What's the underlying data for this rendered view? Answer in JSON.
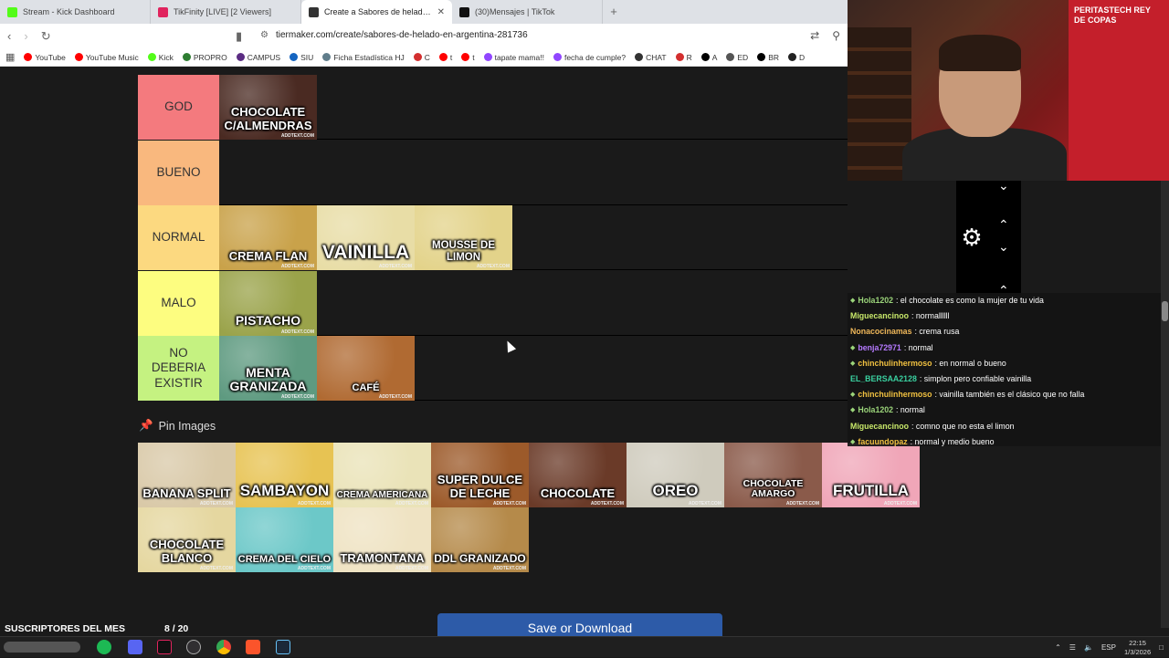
{
  "browser": {
    "tabs": [
      {
        "title": "Stream - Kick Dashboard",
        "color": "#53fc18"
      },
      {
        "title": "TikFinity [LIVE] [2 Viewers]",
        "color": "#e0245e"
      },
      {
        "title": "Create a Sabores de helado en A",
        "color": "#333333",
        "active": true
      },
      {
        "title": "(30)Mensajes | TikTok",
        "color": "#111111"
      }
    ],
    "new_tab": "+",
    "url": "tiermaker.com/create/sabores-de-helado-en-argentina-281736",
    "bookmarks": [
      {
        "label": "YouTube",
        "color": "#ff0000"
      },
      {
        "label": "YouTube Music",
        "color": "#ff0000"
      },
      {
        "label": "Kick",
        "color": "#53fc18"
      },
      {
        "label": "PROPRO",
        "color": "#2e7d32"
      },
      {
        "label": "CAMPUS",
        "color": "#5b2c83"
      },
      {
        "label": "SIU",
        "color": "#1565c0"
      },
      {
        "label": "Ficha Estadística HJ",
        "color": "#607d8b"
      },
      {
        "label": "C",
        "color": "#d32f2f"
      },
      {
        "label": "t",
        "color": "#ff0000"
      },
      {
        "label": "t",
        "color": "#ff0000"
      },
      {
        "label": "tapate mama!!",
        "color": "#9146ff"
      },
      {
        "label": "fecha de cumple?",
        "color": "#9146ff"
      },
      {
        "label": "CHAT",
        "color": "#333333"
      },
      {
        "label": "R",
        "color": "#d32f2f"
      },
      {
        "label": "A",
        "color": "#000000"
      },
      {
        "label": "ED",
        "color": "#555555"
      },
      {
        "label": "BR",
        "color": "#000000"
      },
      {
        "label": "D",
        "color": "#222222"
      }
    ]
  },
  "tiers": [
    {
      "label": "GOD",
      "color": "#f47a7e",
      "items": [
        {
          "label": "CHOCOLATE C/ALMENDRAS",
          "bg": "#4a2a22",
          "size": 13
        }
      ]
    },
    {
      "label": "BUENO",
      "color": "#f9b87e",
      "items": []
    },
    {
      "label": "NORMAL",
      "color": "#fcd980",
      "items": [
        {
          "label": "CREMA FLAN",
          "bg": "#c9a24a",
          "size": 13
        },
        {
          "label": "VAINILLA",
          "bg": "#e8dda6",
          "size": 21
        },
        {
          "label": "MOUSSE DE LIMON",
          "bg": "#e3d38a",
          "size": 11.5
        }
      ]
    },
    {
      "label": "MALO",
      "color": "#fdfd80",
      "items": [
        {
          "label": "PISTACHO",
          "bg": "#9aa34a",
          "size": 14
        }
      ]
    },
    {
      "label": "NO DEBERIA EXISTIR",
      "color": "#c5f281",
      "items": [
        {
          "label": "MENTA GRANIZADA",
          "bg": "#5e9a80",
          "size": 14
        },
        {
          "label": "CAFÉ",
          "bg": "#b06a32",
          "size": 11
        }
      ]
    }
  ],
  "pin": {
    "title": "Pin Images",
    "items": [
      {
        "label": "BANANA SPLIT",
        "bg": "#d9c9a8",
        "size": 13
      },
      {
        "label": "SAMBAYON",
        "bg": "#e7c353",
        "size": 17
      },
      {
        "label": "CREMA AMERICANA",
        "bg": "#eae3b8",
        "size": 10
      },
      {
        "label": "SUPER DULCE DE LECHE",
        "bg": "#9c5a2a",
        "size": 13
      },
      {
        "label": "CHOCOLATE",
        "bg": "#6a3a28",
        "size": 13
      },
      {
        "label": "OREO",
        "bg": "#cfcbbd",
        "size": 17
      },
      {
        "label": "CHOCOLATE AMARGO",
        "bg": "#8a5a4a",
        "size": 10.5
      },
      {
        "label": "FRUTILLA",
        "bg": "#f0a6b8",
        "size": 17
      },
      {
        "label": "CHOCOLATE BLANCO",
        "bg": "#e5d7a0",
        "size": 13
      },
      {
        "label": "CREMA DEL CIELO",
        "bg": "#6cc8c8",
        "size": 11
      },
      {
        "label": "TRAMONTANA",
        "bg": "#efe3c3",
        "size": 13
      },
      {
        "label": "DDL GRANIZADO",
        "bg": "#b58a4a",
        "size": 12
      }
    ]
  },
  "watermark": "ADDTEXT.COM",
  "save_button": "Save or Download",
  "webcam": {
    "banner": "PERITASTECH REY DE COPAS"
  },
  "chat": [
    {
      "user": "Hola1202",
      "color": "#9bd47a",
      "badge": true,
      "msg": ": el chocolate es como la mujer de tu vida"
    },
    {
      "user": "Miguecancinoo",
      "color": "#c8e86a",
      "badge": false,
      "msg": ": normallllll"
    },
    {
      "user": "Nonacocinamas",
      "color": "#f0b85a",
      "badge": false,
      "msg": ": crema rusa"
    },
    {
      "user": "benja72971",
      "color": "#b57aff",
      "badge": true,
      "msg": ": normal"
    },
    {
      "user": "chinchulinhermoso",
      "color": "#f0c040",
      "badge": true,
      "msg": ": en normal o bueno"
    },
    {
      "user": "EL_BERSAA2128",
      "color": "#3ad0a0",
      "badge": false,
      "msg": ": simplon pero confiable vainilla"
    },
    {
      "user": "chinchulinhermoso",
      "color": "#f0c040",
      "badge": true,
      "msg": ": vainilla también es el clásico que no falla"
    },
    {
      "user": "Hola1202",
      "color": "#9bd47a",
      "badge": true,
      "msg": ": normal"
    },
    {
      "user": "Miguecancinoo",
      "color": "#c8e86a",
      "badge": false,
      "msg": ": comno que no esta el limon"
    },
    {
      "user": "facuundopaz",
      "color": "#f0c040",
      "badge": true,
      "msg": ": normal y medio bueno"
    }
  ],
  "subs": {
    "label": "SUSCRIPTORES DEL MES",
    "count": "8 / 20"
  },
  "taskbar": {
    "lang": "ESP",
    "time": "22:15",
    "date": "1/3/2026"
  }
}
